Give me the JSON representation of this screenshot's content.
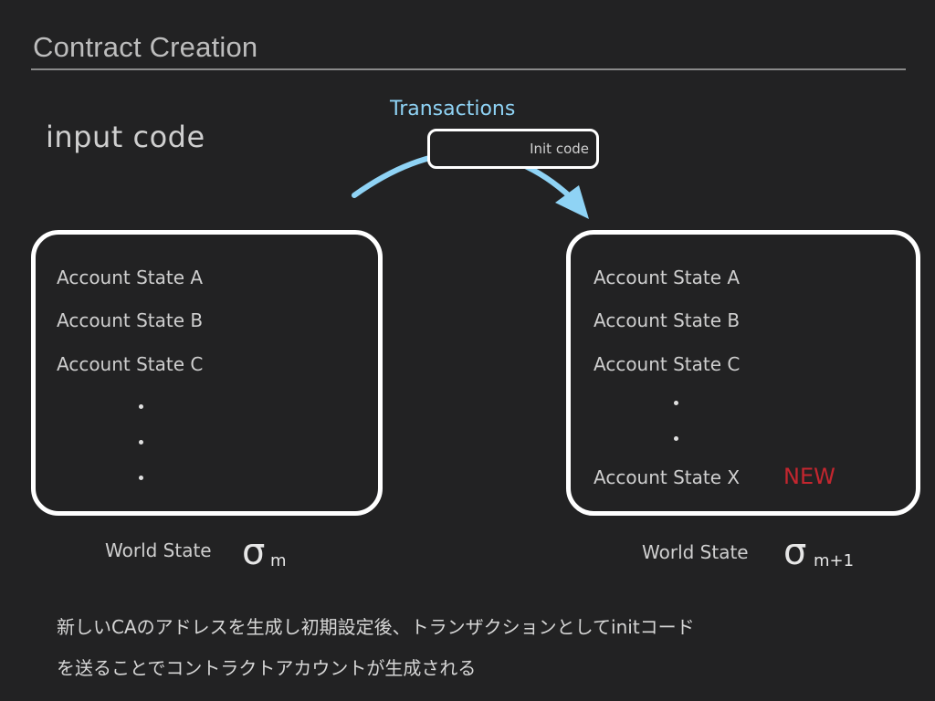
{
  "title": "Contract Creation",
  "subtitle": "input code",
  "transactions_label": "Transactions",
  "init_code_label": "Init code",
  "left_state": {
    "items": [
      "Account State A",
      "Account State B",
      "Account State C"
    ],
    "world_state_label": "World State",
    "sigma": "σ",
    "subscript": "m"
  },
  "right_state": {
    "items": [
      "Account State A",
      "Account State B",
      "Account State C"
    ],
    "new_item": "Account State X",
    "new_badge": "NEW",
    "world_state_label": "World State",
    "sigma": "σ",
    "subscript": "m+1"
  },
  "note_lines": [
    "新しいCAのアドレスを生成し初期設定後、トランザクションとしてinitコード",
    "を送ることでコントラクトアカウントが生成される"
  ],
  "colors": {
    "background": "#222223",
    "arrow": "#8fd3f5",
    "new_badge": "#c4262f",
    "box_border": "#ffffff"
  }
}
